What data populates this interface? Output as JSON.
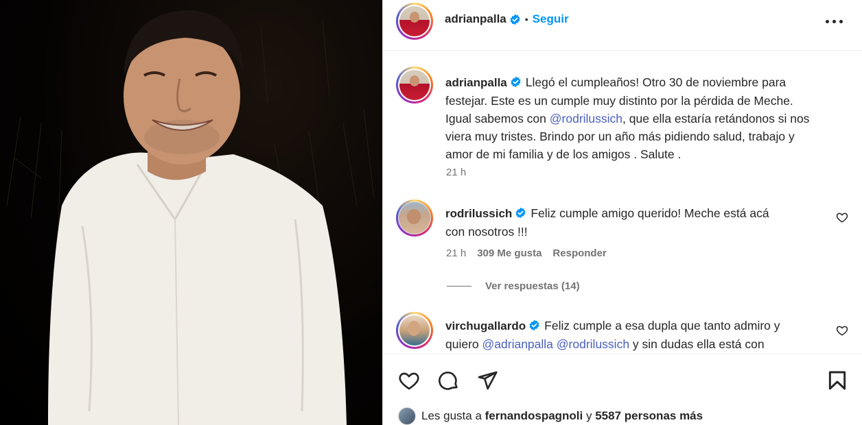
{
  "post": {
    "username": "adrianpalla",
    "separator": "•",
    "follow_label": "Seguir"
  },
  "caption": {
    "username": "adrianpalla",
    "line1": "Llegó el cumpleaños! Otro 30 de noviembre para",
    "line2": "festejar. Este es un cumple muy distinto por la pérdida de Meche.",
    "line3_pre": "Igual sabemos con ",
    "line3_mention": "@rodrilussich",
    "line3_post": ", que ella estaría retándonos si nos",
    "line4": "viera muy tristes. Brindo por un año más pidiendo salud, trabajo y",
    "line5": "amor de mi familia y de los amigos . Salute .",
    "time": "21 h"
  },
  "comments": [
    {
      "username": "rodrilussich",
      "line1": "Feliz cumple amigo querido! Meche está acá",
      "line2": "con nosotros !!!",
      "time": "21 h",
      "likes": "309 Me gusta",
      "reply_label": "Responder",
      "view_replies": "Ver respuestas (14)"
    },
    {
      "username": "virchugallardo",
      "line1": "Feliz cumple a esa dupla que tanto admiro y",
      "line2_pre": "quiero ",
      "line2_mention1": "@adrianpalla",
      "line2_mention2": "@rodrilussich",
      "line2_post": " y sin dudas ella está con"
    }
  ],
  "likes_line": {
    "prefix": "Les gusta a ",
    "user": "fernandospagnoli",
    "middle": " y ",
    "count": "5587 personas más"
  },
  "icons": [
    "more-options-icon",
    "verified-badge-icon",
    "heart-icon",
    "comment-icon",
    "share-icon",
    "bookmark-icon"
  ],
  "colors": {
    "accent": "#0095f6",
    "verified": "#0095f6",
    "mention": "#4a5fc1",
    "muted": "#737373"
  }
}
